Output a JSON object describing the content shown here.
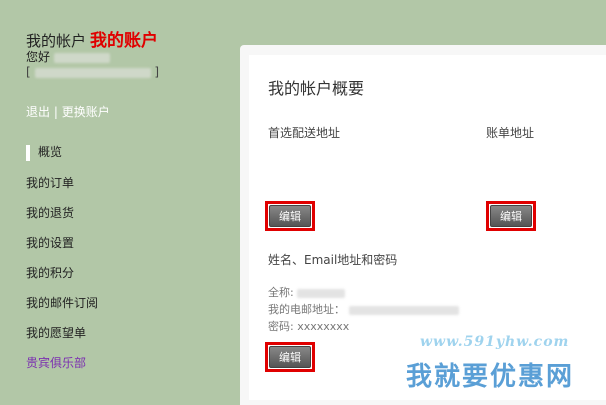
{
  "sidebar": {
    "heading_prefix": "我的帐户",
    "heading_highlight": "我的账户",
    "greeting": "您好",
    "bracket_open": "[",
    "bracket_close": "]",
    "logout": "退出",
    "separator": "|",
    "switch_account": "更换账户",
    "nav": [
      {
        "label": "概览"
      },
      {
        "label": "我的订单"
      },
      {
        "label": "我的退货"
      },
      {
        "label": "我的设置"
      },
      {
        "label": "我的积分"
      },
      {
        "label": "我的邮件订阅"
      },
      {
        "label": "我的愿望单"
      },
      {
        "label": "贵宾俱乐部"
      }
    ]
  },
  "main": {
    "title": "我的帐户概要",
    "shipping_label": "首选配送地址",
    "billing_label": "账单地址",
    "edit_label": "编辑",
    "info_section": "姓名、Email地址和密码",
    "fullname_label": "全称:",
    "email_label": "我的电邮地址：",
    "password_label": "密码:",
    "password_value": "xxxxxxxx"
  },
  "watermark": {
    "url": "www.591yhw.com",
    "text": "我就要优惠网"
  },
  "colors": {
    "background": "#b2c7a7",
    "highlight": "#e00000",
    "vip": "#7b2fb0"
  }
}
